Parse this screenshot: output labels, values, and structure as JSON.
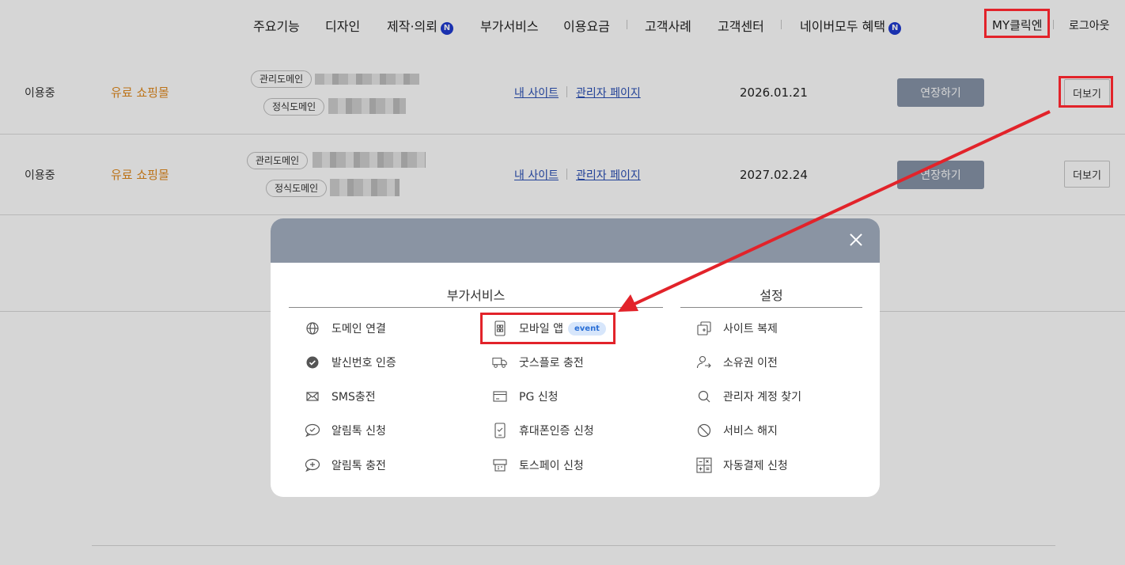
{
  "nav": {
    "items": [
      "주요기능",
      "디자인",
      "제작·의뢰",
      "부가서비스",
      "이용요금",
      "고객사례",
      "고객센터",
      "네이버모두 혜택"
    ],
    "badge": "N",
    "my": "MY클릭엔",
    "logout": "로그아웃"
  },
  "rows": [
    {
      "status": "이용중",
      "product": "유료 쇼핑몰",
      "admin_domain_label": "관리도메인",
      "main_domain_label": "정식도메인",
      "my_site": "내 사이트",
      "admin_page": "관리자 페이지",
      "date": "2026.01.21",
      "extend": "연장하기",
      "more": "더보기"
    },
    {
      "status": "이용중",
      "product": "유료 쇼핑몰",
      "admin_domain_label": "관리도메인",
      "main_domain_label": "정식도메인",
      "my_site": "내 사이트",
      "admin_page": "관리자 페이지",
      "date": "2027.02.24",
      "extend": "연장하기",
      "more": "더보기"
    }
  ],
  "modal": {
    "addon_title": "부가서비스",
    "settings_title": "설정",
    "addon_col1": [
      {
        "label": "도메인 연결",
        "icon": "globe-icon"
      },
      {
        "label": "발신번호 인증",
        "icon": "verified-check-icon"
      },
      {
        "label": "SMS충전",
        "icon": "envelope-icon"
      },
      {
        "label": "알림톡 신청",
        "icon": "chat-check-icon"
      },
      {
        "label": "알림톡 충전",
        "icon": "chat-plus-icon"
      }
    ],
    "addon_col2": [
      {
        "label": "모바일 앱",
        "icon": "mobile-app-icon",
        "badge": "event"
      },
      {
        "label": "굿스플로 충전",
        "icon": "truck-icon"
      },
      {
        "label": "PG 신청",
        "icon": "card-icon"
      },
      {
        "label": "휴대폰인증 신청",
        "icon": "phone-check-icon"
      },
      {
        "label": "토스페이 신청",
        "icon": "pos-terminal-icon"
      }
    ],
    "settings": [
      {
        "label": "사이트 복제",
        "icon": "copy-icon"
      },
      {
        "label": "소유권 이전",
        "icon": "user-transfer-icon"
      },
      {
        "label": "관리자 계정 찾기",
        "icon": "search-icon"
      },
      {
        "label": "서비스 해지",
        "icon": "ban-icon"
      },
      {
        "label": "자동결제 신청",
        "icon": "calculator-icon"
      }
    ]
  },
  "colors": {
    "highlight": "#e2232a",
    "product": "#e08a1e",
    "link": "#2a4fb5",
    "extend_button": "#8794a8",
    "modal_header": "#8a94a3",
    "event_badge_bg": "#d7e6fb",
    "event_badge_text": "#2a6fd6"
  }
}
